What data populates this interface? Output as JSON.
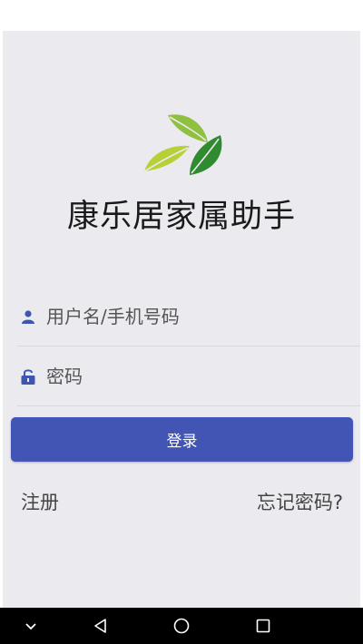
{
  "app": {
    "title": "康乐居家属助手"
  },
  "form": {
    "username_placeholder": "用户名/手机号码",
    "password_placeholder": "密码",
    "login_label": "登录"
  },
  "links": {
    "register": "注册",
    "forgot_password": "忘记密码?"
  },
  "icons": {
    "logo": "leaf-logo",
    "username": "user-icon",
    "password": "lock-icon",
    "nav_down": "chevron-down-icon",
    "nav_back": "back-triangle-icon",
    "nav_home": "home-circle-icon",
    "nav_recent": "recents-square-icon"
  },
  "colors": {
    "accent": "#4254b4",
    "background": "#ebeaef",
    "logo_light": "#b7d03a",
    "logo_mid": "#74b33c",
    "logo_dark": "#2f8a30"
  }
}
